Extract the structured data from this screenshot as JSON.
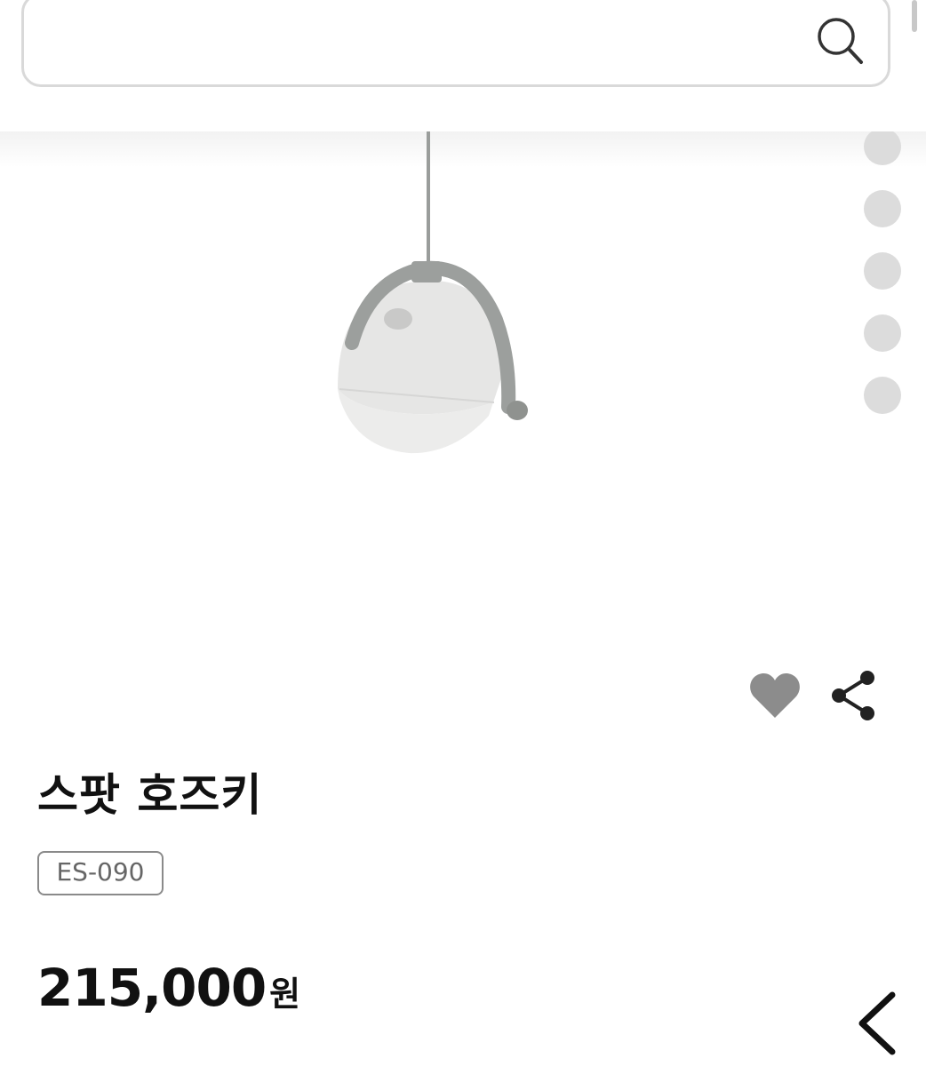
{
  "search": {
    "value": "",
    "placeholder": ""
  },
  "gallery": {
    "image_count": 5,
    "active_index": 0
  },
  "product": {
    "name": "스팟 호즈키",
    "model": "ES-090",
    "price": "215,000",
    "price_unit": "원"
  },
  "icons": {
    "search": "search-icon",
    "heart": "heart-icon",
    "share": "share-icon",
    "back": "chevron-left-icon"
  },
  "colors": {
    "heart": "#8c8c8c",
    "dot": "#dcdcdc",
    "border": "#d9d9d9",
    "text": "#111111"
  }
}
